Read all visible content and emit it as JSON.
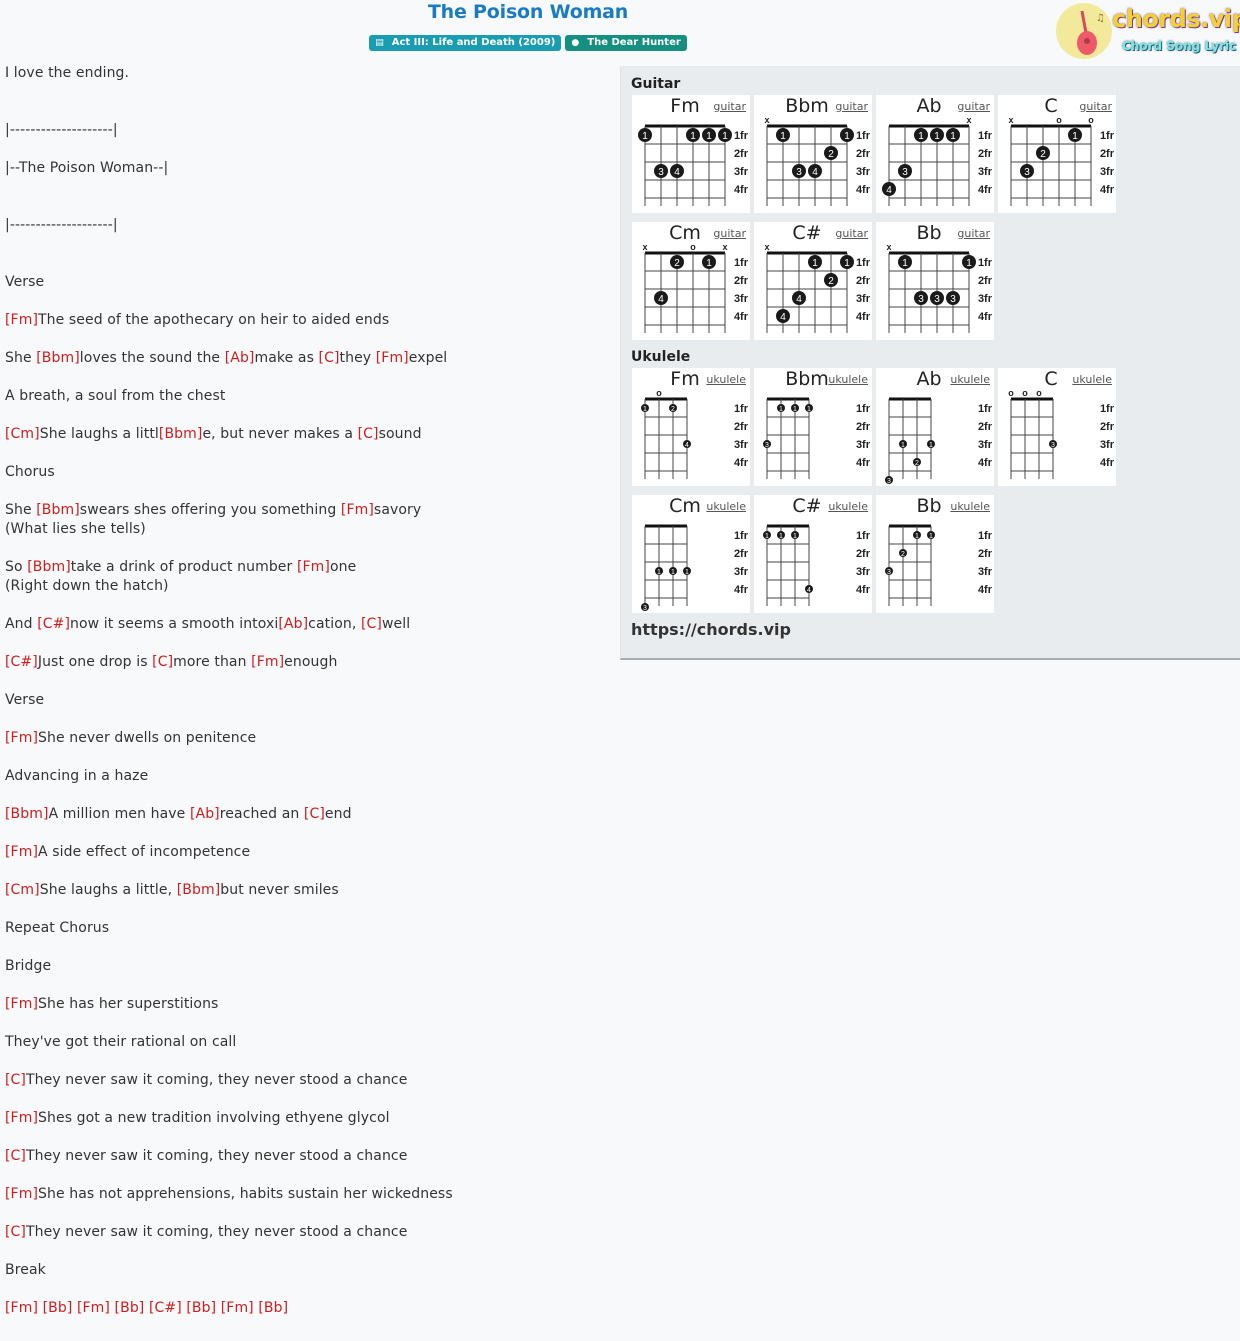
{
  "header": {
    "title": "The Poison Woman",
    "album_badge": "Act III: Life and Death (2009)",
    "album_icon": "book-icon",
    "artist_badge": "The Dear Hunter",
    "artist_icon": "user-icon"
  },
  "logo": {
    "name": "chords.vip",
    "tagline": "Chord Song Lyric"
  },
  "colors": {
    "title": "#1a7bc4",
    "chord": "#d01c1c",
    "album_badge": "#1a9db0",
    "artist_badge": "#148f80",
    "panel": "#e9ecef"
  },
  "lyrics": [
    [
      {
        "t": "I love the ending."
      }
    ],
    [],
    [],
    [
      {
        "t": "|--------------------|"
      }
    ],
    [],
    [
      {
        "t": "|--The Poison Woman--|"
      }
    ],
    [],
    [],
    [
      {
        "t": "|--------------------|"
      }
    ],
    [],
    [],
    [
      {
        "t": "Verse"
      }
    ],
    [],
    [
      {
        "c": "[Fm]"
      },
      {
        "t": "The seed of the apothecary on heir to aided ends"
      }
    ],
    [],
    [
      {
        "t": "She "
      },
      {
        "c": "[Bbm]"
      },
      {
        "t": "loves the sound the "
      },
      {
        "c": "[Ab]"
      },
      {
        "t": "make as "
      },
      {
        "c": "[C]"
      },
      {
        "t": "they "
      },
      {
        "c": "[Fm]"
      },
      {
        "t": "expel"
      }
    ],
    [],
    [
      {
        "t": "A breath, a soul from the chest"
      }
    ],
    [],
    [
      {
        "c": "[Cm]"
      },
      {
        "t": "She laughs a littl"
      },
      {
        "c": "[Bbm]"
      },
      {
        "t": "e, but never makes a "
      },
      {
        "c": "[C]"
      },
      {
        "t": "sound"
      }
    ],
    [],
    [
      {
        "t": "Chorus"
      }
    ],
    [],
    [
      {
        "t": "She "
      },
      {
        "c": "[Bbm]"
      },
      {
        "t": "swears shes offering you something "
      },
      {
        "c": "[Fm]"
      },
      {
        "t": "savory"
      }
    ],
    [
      {
        "t": "(What lies she tells)"
      }
    ],
    [],
    [
      {
        "t": "So "
      },
      {
        "c": "[Bbm]"
      },
      {
        "t": "take a drink of product number "
      },
      {
        "c": "[Fm]"
      },
      {
        "t": "one"
      }
    ],
    [
      {
        "t": "(Right down the hatch)"
      }
    ],
    [],
    [
      {
        "t": "And "
      },
      {
        "c": "[C#]"
      },
      {
        "t": "now it seems a smooth intoxi"
      },
      {
        "c": "[Ab]"
      },
      {
        "t": "cation, "
      },
      {
        "c": "[C]"
      },
      {
        "t": "well"
      }
    ],
    [],
    [
      {
        "c": "[C#]"
      },
      {
        "t": "Just one drop is "
      },
      {
        "c": "[C]"
      },
      {
        "t": "more than "
      },
      {
        "c": "[Fm]"
      },
      {
        "t": "enough"
      }
    ],
    [],
    [
      {
        "t": "Verse"
      }
    ],
    [],
    [
      {
        "c": "[Fm]"
      },
      {
        "t": "She never dwells on penitence"
      }
    ],
    [],
    [
      {
        "t": "Advancing in a haze"
      }
    ],
    [],
    [
      {
        "c": "[Bbm]"
      },
      {
        "t": "A million men have "
      },
      {
        "c": "[Ab]"
      },
      {
        "t": "reached an "
      },
      {
        "c": "[C]"
      },
      {
        "t": "end"
      }
    ],
    [],
    [
      {
        "c": "[Fm]"
      },
      {
        "t": "A side effect of incompetence"
      }
    ],
    [],
    [
      {
        "c": "[Cm]"
      },
      {
        "t": "She laughs a little, "
      },
      {
        "c": "[Bbm]"
      },
      {
        "t": "but never smiles"
      }
    ],
    [],
    [
      {
        "t": "Repeat Chorus"
      }
    ],
    [],
    [
      {
        "t": "Bridge"
      }
    ],
    [],
    [
      {
        "c": "[Fm]"
      },
      {
        "t": "She has her superstitions"
      }
    ],
    [],
    [
      {
        "t": "They've got their rational on call"
      }
    ],
    [],
    [
      {
        "c": "[C]"
      },
      {
        "t": "They never saw it coming, they never stood a chance"
      }
    ],
    [],
    [
      {
        "c": "[Fm]"
      },
      {
        "t": "Shes got a new tradition involving ethyene glycol"
      }
    ],
    [],
    [
      {
        "c": "[C]"
      },
      {
        "t": "They never saw it coming, they never stood a chance"
      }
    ],
    [],
    [
      {
        "c": "[Fm]"
      },
      {
        "t": "She has not apprehensions, habits sustain her wickedness"
      }
    ],
    [],
    [
      {
        "c": "[C]"
      },
      {
        "t": "They never saw it coming, they never stood a chance"
      }
    ],
    [],
    [
      {
        "t": "Break"
      }
    ],
    [],
    [
      {
        "c": "[Fm]"
      },
      {
        "t": " "
      },
      {
        "c": "[Bb]"
      },
      {
        "t": " "
      },
      {
        "c": "[Fm]"
      },
      {
        "t": " "
      },
      {
        "c": "[Bb]"
      },
      {
        "t": " "
      },
      {
        "c": "[C#]"
      },
      {
        "t": " "
      },
      {
        "c": "[Bb]"
      },
      {
        "t": " "
      },
      {
        "c": "[Fm]"
      },
      {
        "t": " "
      },
      {
        "c": "[Bb]"
      }
    ]
  ],
  "chords_panel": {
    "guitar_label": "Guitar",
    "ukulele_label": "Ukulele",
    "fret_labels": [
      "1fr",
      "2fr",
      "3fr",
      "4fr"
    ],
    "guitar": [
      {
        "name": "Fm",
        "link": "guitar",
        "markers": [
          "",
          "",
          "",
          "",
          "",
          ""
        ],
        "dots": [
          [
            1,
            1,
            "1"
          ],
          [
            2,
            3,
            "3"
          ],
          [
            3,
            3,
            "4"
          ],
          [
            4,
            1,
            "1"
          ],
          [
            5,
            1,
            "1"
          ],
          [
            6,
            1,
            "1"
          ]
        ]
      },
      {
        "name": "Bbm",
        "link": "guitar",
        "markers": [
          "x",
          "",
          "",
          "",
          "",
          ""
        ],
        "dots": [
          [
            2,
            1,
            "1"
          ],
          [
            3,
            3,
            "3"
          ],
          [
            4,
            3,
            "4"
          ],
          [
            5,
            2,
            "2"
          ],
          [
            6,
            1,
            "1"
          ]
        ]
      },
      {
        "name": "Ab",
        "link": "guitar",
        "markers": [
          "",
          "",
          "",
          "",
          "",
          "x"
        ],
        "dots": [
          [
            1,
            4,
            "4"
          ],
          [
            2,
            3,
            "3"
          ],
          [
            3,
            1,
            "1"
          ],
          [
            4,
            1,
            "1"
          ],
          [
            5,
            1,
            "1"
          ]
        ]
      },
      {
        "name": "C",
        "link": "guitar",
        "markers": [
          "x",
          "",
          "",
          "o",
          "",
          "o"
        ],
        "dots": [
          [
            2,
            3,
            "3"
          ],
          [
            3,
            2,
            "2"
          ],
          [
            5,
            1,
            "1"
          ]
        ]
      },
      {
        "name": "Cm",
        "link": "guitar",
        "markers": [
          "x",
          "",
          "",
          "o",
          "",
          "x"
        ],
        "dots": [
          [
            2,
            3,
            "4"
          ],
          [
            3,
            1,
            "2"
          ],
          [
            5,
            1,
            "1"
          ]
        ]
      },
      {
        "name": "C#",
        "link": "guitar",
        "markers": [
          "x",
          "",
          "",
          "",
          "",
          ""
        ],
        "dots": [
          [
            2,
            4,
            "4"
          ],
          [
            3,
            3,
            "4"
          ],
          [
            4,
            1,
            "1"
          ],
          [
            5,
            2,
            "2"
          ],
          [
            6,
            1,
            "1"
          ]
        ]
      },
      {
        "name": "Bb",
        "link": "guitar",
        "markers": [
          "x",
          "",
          "",
          "",
          "",
          ""
        ],
        "dots": [
          [
            2,
            1,
            "1"
          ],
          [
            3,
            3,
            "3"
          ],
          [
            4,
            3,
            "3"
          ],
          [
            5,
            3,
            "3"
          ],
          [
            6,
            1,
            "1"
          ]
        ]
      }
    ],
    "ukulele": [
      {
        "name": "Fm",
        "link": "ukulele",
        "markers": [
          "",
          "o",
          "",
          ""
        ],
        "dots": [
          [
            1,
            1,
            "1"
          ],
          [
            3,
            1,
            "2"
          ],
          [
            4,
            3,
            "4"
          ]
        ]
      },
      {
        "name": "Bbm",
        "link": "ukulele",
        "markers": [
          "",
          "",
          "",
          ""
        ],
        "dots": [
          [
            1,
            3,
            "3"
          ],
          [
            2,
            1,
            "1"
          ],
          [
            3,
            1,
            "1"
          ],
          [
            4,
            1,
            "1"
          ]
        ]
      },
      {
        "name": "Ab",
        "link": "ukulele",
        "markers": [
          "",
          "",
          "",
          ""
        ],
        "dots": [
          [
            1,
            5,
            "3"
          ],
          [
            2,
            3,
            "1"
          ],
          [
            3,
            4,
            "2"
          ],
          [
            4,
            3,
            "1"
          ]
        ]
      },
      {
        "name": "C",
        "link": "ukulele",
        "markers": [
          "o",
          "o",
          "o",
          ""
        ],
        "dots": [
          [
            4,
            3,
            "3"
          ]
        ]
      },
      {
        "name": "Cm",
        "link": "ukulele",
        "markers": [
          "",
          "",
          "",
          ""
        ],
        "dots": [
          [
            1,
            5,
            "3"
          ],
          [
            2,
            3,
            "1"
          ],
          [
            3,
            3,
            "1"
          ],
          [
            4,
            3,
            "1"
          ]
        ]
      },
      {
        "name": "C#",
        "link": "ukulele",
        "markers": [
          "",
          "",
          "",
          ""
        ],
        "dots": [
          [
            1,
            1,
            "1"
          ],
          [
            2,
            1,
            "1"
          ],
          [
            3,
            1,
            "1"
          ],
          [
            4,
            4,
            "4"
          ]
        ]
      },
      {
        "name": "Bb",
        "link": "ukulele",
        "markers": [
          "",
          "",
          "",
          ""
        ],
        "dots": [
          [
            1,
            3,
            "3"
          ],
          [
            2,
            2,
            "2"
          ],
          [
            3,
            1,
            "1"
          ],
          [
            4,
            1,
            "1"
          ]
        ]
      }
    ],
    "url": "https://chords.vip"
  }
}
